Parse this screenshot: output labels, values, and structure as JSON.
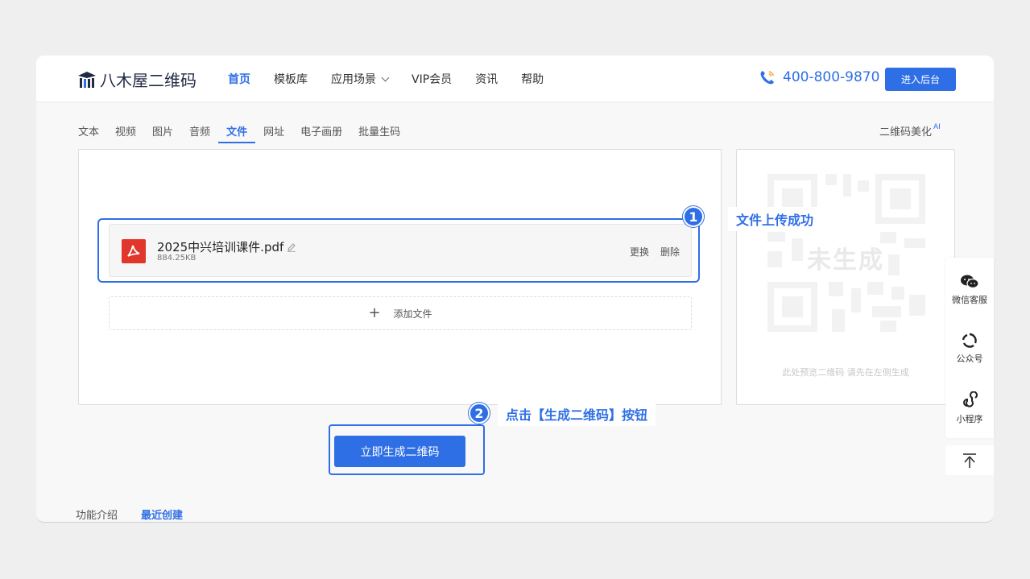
{
  "header": {
    "logo_text": "八木屋二维码",
    "nav": [
      {
        "label": "首页",
        "active": true
      },
      {
        "label": "模板库"
      },
      {
        "label": "应用场景",
        "dropdown": true
      },
      {
        "label": "VIP会员"
      },
      {
        "label": "资讯"
      },
      {
        "label": "帮助"
      }
    ],
    "phone": "400-800-9870",
    "backend_button": "进入后台"
  },
  "tabs": [
    "文本",
    "视频",
    "图片",
    "音频",
    "文件",
    "网址",
    "电子画册",
    "批量生码"
  ],
  "active_tab": "文件",
  "beautify": {
    "label": "二维码美化",
    "badge": "AI"
  },
  "file": {
    "name": "2025中兴培训课件.pdf",
    "size": "884.25KB",
    "replace": "更换",
    "delete": "删除"
  },
  "add_file": "添加文件",
  "callouts": {
    "step1_number": "1",
    "step1_text": "文件上传成功",
    "step2_number": "2",
    "step2_text": "点击【生成二维码】按钮"
  },
  "preview": {
    "placeholder": "未生成",
    "hint": "此处预览二维码 请先在左侧生成"
  },
  "generate_button": "立即生成二维码",
  "bottom_tabs": [
    {
      "label": "功能介绍"
    },
    {
      "label": "最近创建",
      "active": true
    }
  ],
  "float_bar": {
    "wechat": "微信客服",
    "official": "公众号",
    "miniprogram": "小程序"
  },
  "colors": {
    "accent": "#2f6fe6",
    "pdf": "#e0362c"
  },
  "icons": [
    "logo-icon",
    "phone-icon",
    "pdf-icon",
    "edit-icon",
    "plus-icon",
    "wechat-icon",
    "official-account-icon",
    "miniprogram-icon",
    "back-to-top-icon"
  ]
}
